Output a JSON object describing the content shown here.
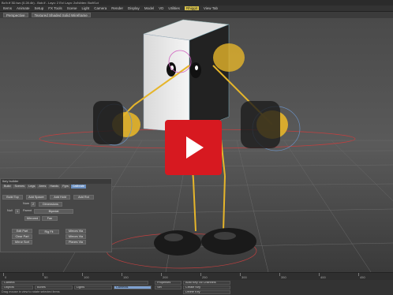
{
  "window": {
    "title": "Bo'b.tf 3D.lwo (0.28.4b) - Bob.lf - Layo: 2 Ex/ Layo: 2x/bl/dev: Bo/tf1ct"
  },
  "menubar": {
    "items": [
      "Items",
      "Animate",
      "Setup",
      "FX Tools",
      "Scene",
      "Light",
      "Camera",
      "Render",
      "Display",
      "Model",
      "VD",
      "Utilities",
      "Rhiggit",
      "View Tab"
    ],
    "active_index": 12
  },
  "viewbar": {
    "view_select": "Perspective",
    "shading_select": "Textured Shaded Solid Wireframe"
  },
  "panel": {
    "title": "Ikey builder",
    "tabs": [
      "Build",
      "Scenes",
      "Legs",
      "Arms",
      "Hands",
      "Fgrs",
      "Calibrate"
    ],
    "active_tab": 6,
    "row1": [
      "Build Top",
      "Add Spacer",
      "Add Hold",
      "Add Rot"
    ],
    "row2_label": "Num",
    "row2_value": "2",
    "row2_button": "Dimensions",
    "row3_label": "Null",
    "row3_value": "1",
    "row3_label2": "Parent",
    "row3_select": "Bipedal",
    "row4": [
      "Mirrored",
      "Fan"
    ],
    "left_buttons": [
      "Edit Part",
      "Clear Part",
      "Mirror Sort"
    ],
    "center_button": "Rig Fit",
    "right_buttons": [
      "Mirrors Via",
      "Mirrors Via",
      "Planes Via"
    ]
  },
  "timeline": {
    "ticks": [
      "0",
      "50",
      "100",
      "150",
      "200",
      "250",
      "300",
      "350",
      "400",
      "450"
    ]
  },
  "bottombar": {
    "camera_label": "Camera",
    "objects_label": "Objects",
    "bones_label": "Bones",
    "lights_label": "Lights",
    "cameras_label": "Cameras",
    "properties_label": "Properties",
    "set_label": "Set",
    "autokey_label": "Auto Key: All Channels",
    "create_key": "Create Key",
    "delete_key": "Delete Key",
    "hint": "Drag mouse in view to rotate selected items"
  },
  "colors": {
    "accent": "#d8c24a",
    "play_button": "#d71920",
    "bone_yellow": "#e6b52a"
  },
  "icons": {
    "play": "play-icon"
  }
}
